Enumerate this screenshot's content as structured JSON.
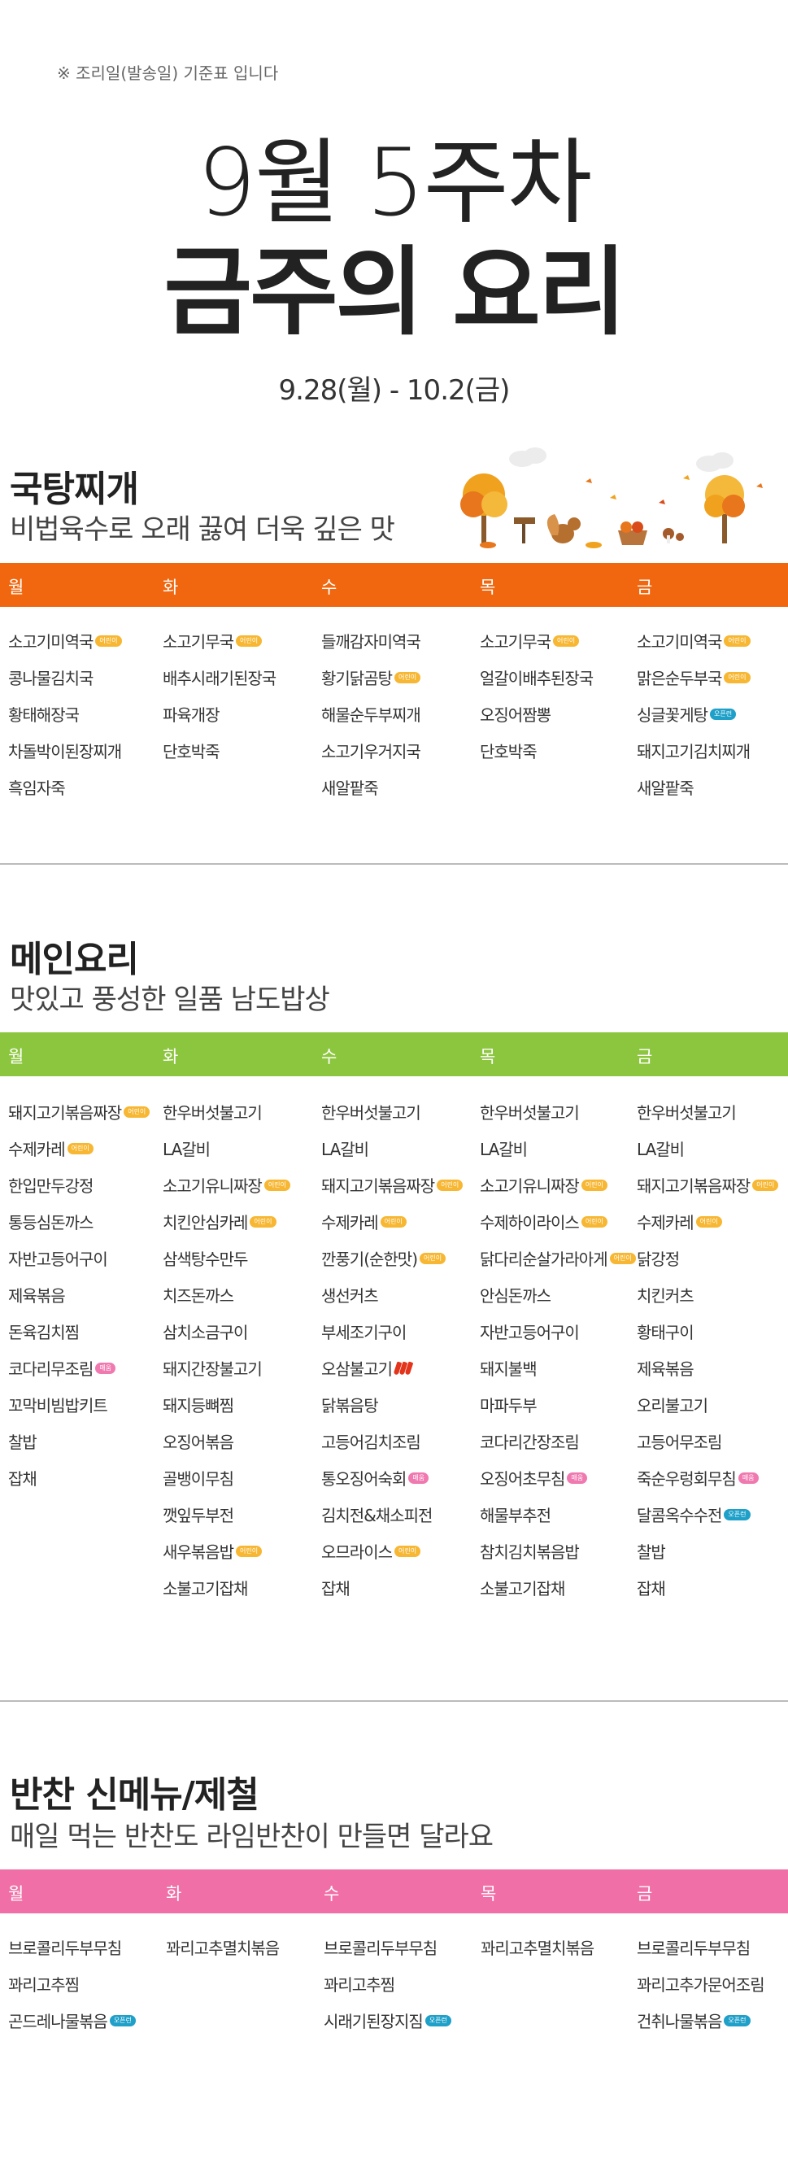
{
  "header": {
    "note": "※ 조리일(발송일) 기준표 입니다",
    "title_week": "9월 5주차",
    "title_main": "금주의 요리",
    "date_range": "9.28(월) - 10.2(금)"
  },
  "days": [
    "월",
    "화",
    "수",
    "목",
    "금"
  ],
  "colors": {
    "soup": "#f0670f",
    "main": "#8cc63e",
    "side": "#f06fa6"
  },
  "tag_labels": {
    "kid": "어린이",
    "spicy": "매움",
    "new": "오픈런"
  },
  "sections": [
    {
      "title": "국탕찌개",
      "subtitle": "비법육수로 오래 끓여 더욱 깊은 맛",
      "columns": [
        [
          {
            "name": "소고기미역국",
            "tag": "kid"
          },
          {
            "name": "콩나물김치국"
          },
          {
            "name": "황태해장국"
          },
          {
            "name": "차돌박이된장찌개"
          },
          {
            "name": "흑임자죽"
          }
        ],
        [
          {
            "name": "소고기무국",
            "tag": "kid"
          },
          {
            "name": "배추시래기된장국"
          },
          {
            "name": "파육개장"
          },
          {
            "name": "단호박죽"
          }
        ],
        [
          {
            "name": "들깨감자미역국"
          },
          {
            "name": "황기닭곰탕",
            "tag": "kid"
          },
          {
            "name": "해물순두부찌개"
          },
          {
            "name": "소고기우거지국"
          },
          {
            "name": "새알팥죽"
          }
        ],
        [
          {
            "name": "소고기무국",
            "tag": "kid"
          },
          {
            "name": "얼갈이배추된장국"
          },
          {
            "name": "오징어짬뽕"
          },
          {
            "name": "단호박죽"
          }
        ],
        [
          {
            "name": "소고기미역국",
            "tag": "kid"
          },
          {
            "name": "맑은순두부국",
            "tag": "kid"
          },
          {
            "name": "싱글꽃게탕",
            "tag": "new"
          },
          {
            "name": "돼지고기김치찌개"
          },
          {
            "name": "새알팥죽"
          }
        ]
      ]
    },
    {
      "title": "메인요리",
      "subtitle": "맛있고 풍성한 일품 남도밥상",
      "columns": [
        [
          {
            "name": "돼지고기볶음짜장",
            "tag": "kid"
          },
          {
            "name": "수제카레",
            "tag": "kid"
          },
          {
            "name": "한입만두강정"
          },
          {
            "name": "통등심돈까스"
          },
          {
            "name": "자반고등어구이"
          },
          {
            "name": "제육볶음"
          },
          {
            "name": "돈육김치찜"
          },
          {
            "name": "코다리무조림",
            "tag": "spicy"
          },
          {
            "name": "꼬막비빔밥키트"
          },
          {
            "name": "찰밥"
          },
          {
            "name": "잡채"
          }
        ],
        [
          {
            "name": "한우버섯불고기"
          },
          {
            "name": "LA갈비"
          },
          {
            "name": "소고기유니짜장",
            "tag": "kid"
          },
          {
            "name": "치킨안심카레",
            "tag": "kid"
          },
          {
            "name": "삼색탕수만두"
          },
          {
            "name": "치즈돈까스"
          },
          {
            "name": "삼치소금구이"
          },
          {
            "name": "돼지간장불고기"
          },
          {
            "name": "돼지등뼈찜"
          },
          {
            "name": "오징어볶음"
          },
          {
            "name": "골뱅이무침"
          },
          {
            "name": "깻잎두부전"
          },
          {
            "name": "새우볶음밥",
            "tag": "kid"
          },
          {
            "name": "소불고기잡채"
          }
        ],
        [
          {
            "name": "한우버섯불고기"
          },
          {
            "name": "LA갈비"
          },
          {
            "name": "돼지고기볶음짜장",
            "tag": "kid"
          },
          {
            "name": "수제카레",
            "tag": "kid"
          },
          {
            "name": "깐풍기(순한맛)",
            "tag": "kid"
          },
          {
            "name": "생선커츠"
          },
          {
            "name": "부세조기구이"
          },
          {
            "name": "오삼불고기",
            "tag": "chili"
          },
          {
            "name": "닭볶음탕"
          },
          {
            "name": "고등어김치조림"
          },
          {
            "name": "통오징어숙회",
            "tag": "spicy"
          },
          {
            "name": "김치전&채소피전"
          },
          {
            "name": "오므라이스",
            "tag": "kid"
          },
          {
            "name": "잡채"
          }
        ],
        [
          {
            "name": "한우버섯불고기"
          },
          {
            "name": "LA갈비"
          },
          {
            "name": "소고기유니짜장",
            "tag": "kid"
          },
          {
            "name": "수제하이라이스",
            "tag": "kid"
          },
          {
            "name": "닭다리순살가라아게",
            "tag": "kid"
          },
          {
            "name": "안심돈까스"
          },
          {
            "name": "자반고등어구이"
          },
          {
            "name": "돼지불백"
          },
          {
            "name": "마파두부"
          },
          {
            "name": "코다리간장조림"
          },
          {
            "name": "오징어초무침",
            "tag": "spicy"
          },
          {
            "name": "해물부추전"
          },
          {
            "name": "참치김치볶음밥"
          },
          {
            "name": "소불고기잡채"
          }
        ],
        [
          {
            "name": "한우버섯불고기"
          },
          {
            "name": "LA갈비"
          },
          {
            "name": "돼지고기볶음짜장",
            "tag": "kid"
          },
          {
            "name": "수제카레",
            "tag": "kid"
          },
          {
            "name": "닭강정"
          },
          {
            "name": "치킨커츠"
          },
          {
            "name": "황태구이"
          },
          {
            "name": "제육볶음"
          },
          {
            "name": "오리불고기"
          },
          {
            "name": "고등어무조림"
          },
          {
            "name": "죽순우렁회무침",
            "tag": "spicy"
          },
          {
            "name": "달콤옥수수전",
            "tag": "new"
          },
          {
            "name": "찰밥"
          },
          {
            "name": "잡채"
          }
        ]
      ]
    },
    {
      "title": "반찬 신메뉴/제철",
      "subtitle": "매일 먹는 반찬도 라임반찬이 만들면 달라요",
      "columns": [
        [
          {
            "name": "브로콜리두부무침"
          },
          {
            "name": "꽈리고추찜"
          },
          {
            "name": "곤드레나물볶음",
            "tag": "new"
          }
        ],
        [
          {
            "name": "꽈리고추멸치볶음"
          }
        ],
        [
          {
            "name": "브로콜리두부무침"
          },
          {
            "name": "꽈리고추찜"
          },
          {
            "name": "시래기된장지짐",
            "tag": "new"
          }
        ],
        [
          {
            "name": "꽈리고추멸치볶음"
          }
        ],
        [
          {
            "name": "브로콜리두부무침"
          },
          {
            "name": "꽈리고추가문어조림"
          },
          {
            "name": "건취나물볶음",
            "tag": "new"
          }
        ]
      ]
    }
  ]
}
